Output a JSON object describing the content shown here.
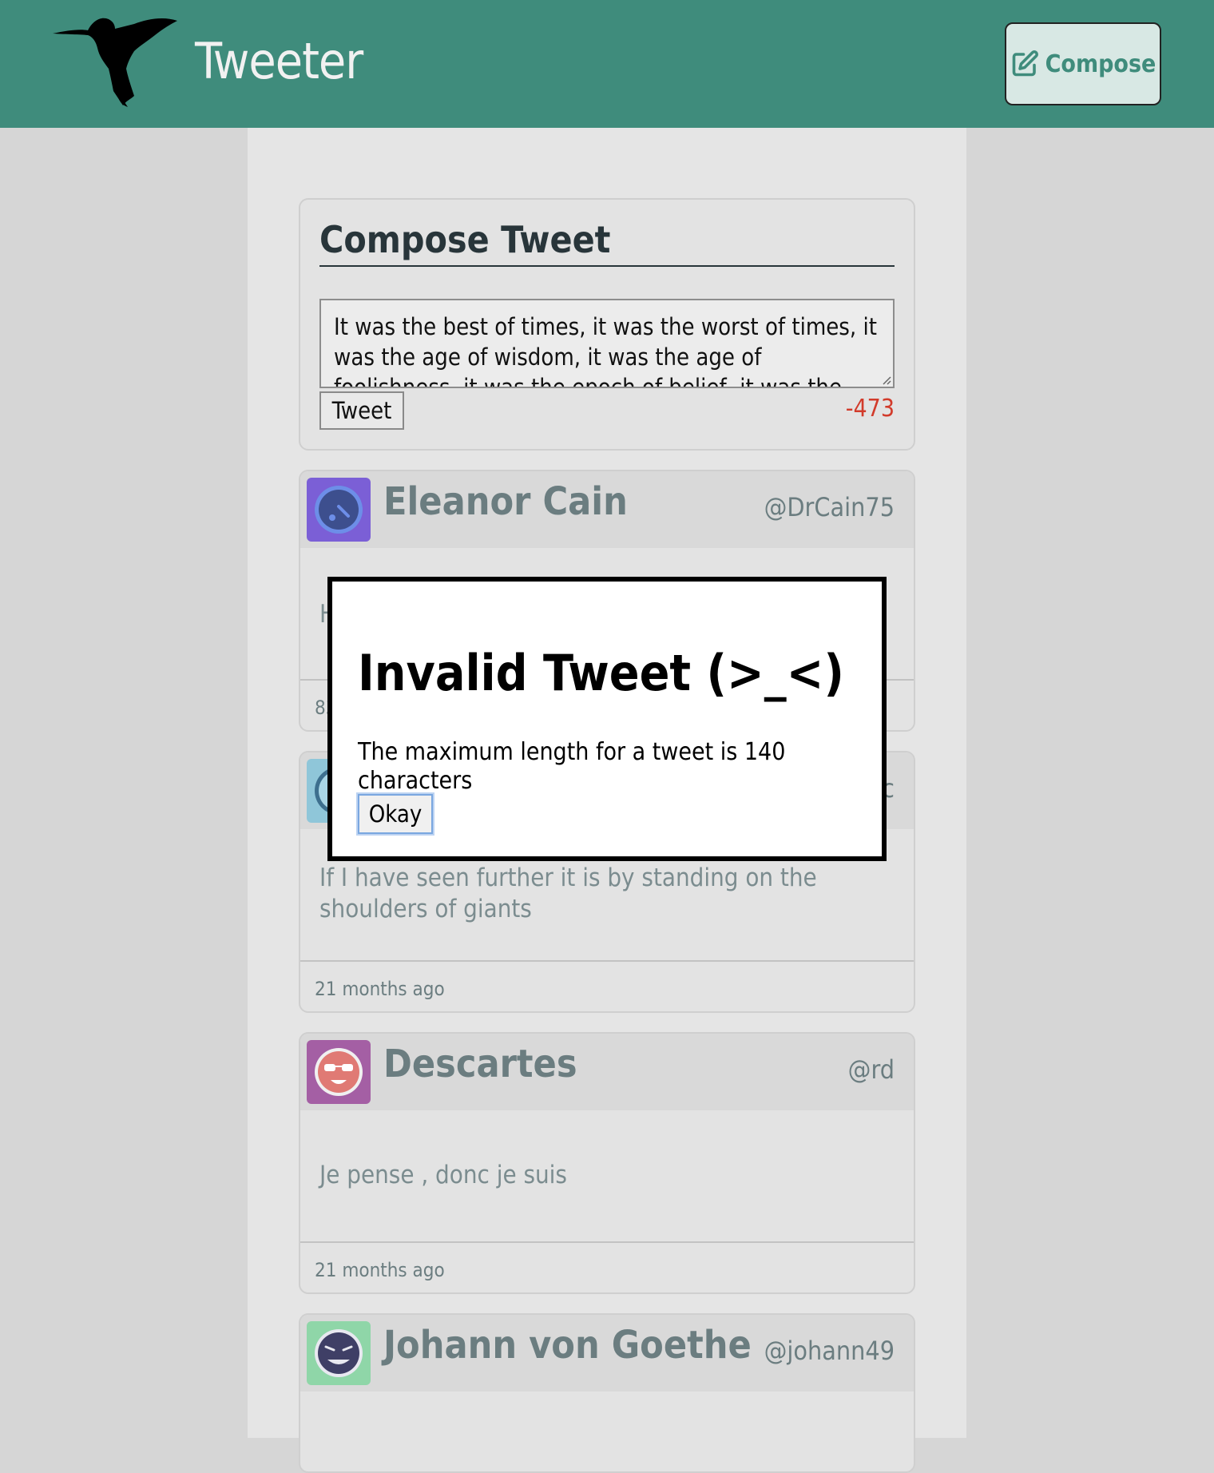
{
  "header": {
    "brand": "Tweeter",
    "compose_label": "Compose",
    "color": "#3f8c7c"
  },
  "compose": {
    "title": "Compose Tweet",
    "text": "It was the best of times, it was the worst of times, it was the age of wisdom, it was the age of foolishness, it was the epoch of belief, it was the epoch of incredulity",
    "tweet_label": "Tweet",
    "counter": "-473",
    "counter_color": "#d23b2b"
  },
  "tweets": [
    {
      "name": "Eleanor Cain",
      "handle": "@DrCain75",
      "text": "H",
      "time": "83",
      "avatar_color": "#7b5fd6"
    },
    {
      "name": "",
      "handle": "c",
      "text": "If I have seen further it is by standing on the shoulders of giants",
      "time": "21 months ago",
      "avatar_color": "#8fc6d9"
    },
    {
      "name": "Descartes",
      "handle": "@rd",
      "text": "Je pense , donc je suis",
      "time": "21 months ago",
      "avatar_color": "#a45fa4"
    },
    {
      "name": "Johann von Goethe",
      "handle": "@johann49",
      "text": "",
      "time": "",
      "avatar_color": "#8fd6a8"
    }
  ],
  "modal": {
    "title": "Invalid Tweet (>_<)",
    "message": "The maximum length for a tweet is 140 characters",
    "okay_label": "Okay"
  }
}
